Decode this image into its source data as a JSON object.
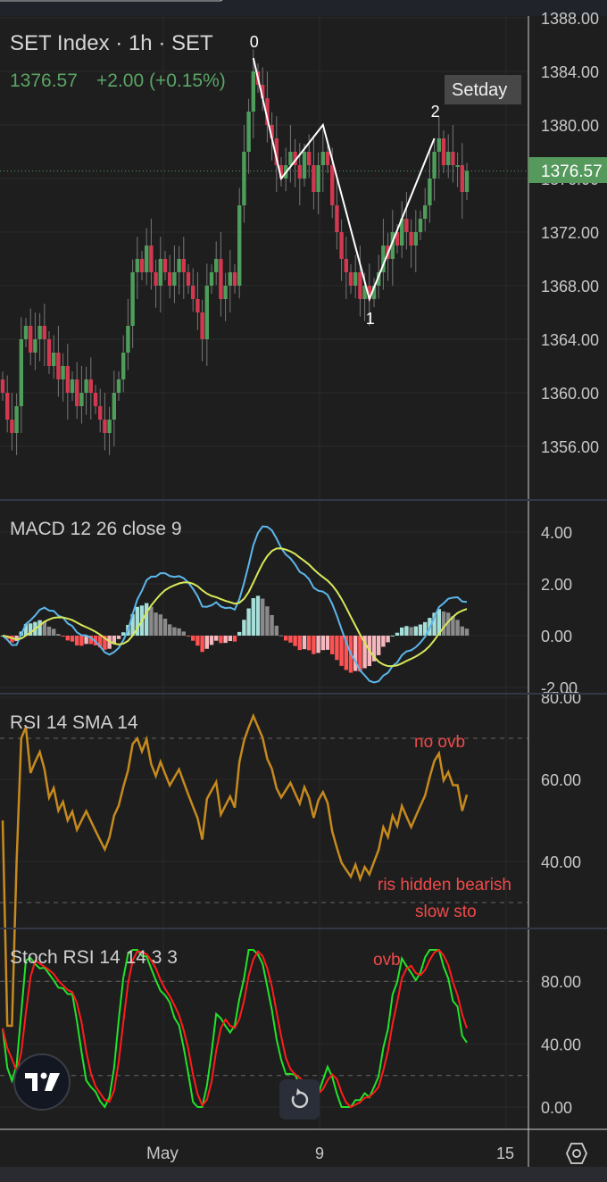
{
  "header": {
    "title": "SET Index · 1h · SET",
    "last": "1376.57",
    "change": "+2.00 (+0.15%)",
    "last_price_tag": "1376.57",
    "legend_badge": "Setday"
  },
  "colors": {
    "up": "#4f9d5a",
    "down": "#d2384f",
    "macd": "#5cb6ea",
    "signal": "#d8e85a",
    "rsi": "#c68a1e",
    "stoch_k": "#22e22a",
    "stoch_d": "#ff1c1c",
    "note": "#f04a4a"
  },
  "chart_data": [
    {
      "type": "candlestick",
      "title": "SET Index · 1h · SET",
      "ylim": [
        1354,
        1388
      ],
      "yticks": [
        "1388.00",
        "1384.00",
        "1380.00",
        "1376.00",
        "1372.00",
        "1368.00",
        "1364.00",
        "1360.00",
        "1356.00"
      ],
      "close": [
        1360,
        1358,
        1357,
        1359,
        1364,
        1365,
        1363,
        1364,
        1365,
        1364,
        1362,
        1363,
        1361,
        1362,
        1360,
        1361,
        1359,
        1360,
        1361,
        1360,
        1359,
        1358,
        1357,
        1358,
        1360,
        1361,
        1363,
        1365,
        1369,
        1370,
        1369,
        1371,
        1369,
        1368,
        1370,
        1369,
        1368,
        1369,
        1370,
        1369,
        1368,
        1367,
        1366,
        1364,
        1368,
        1369,
        1370,
        1367,
        1368,
        1369,
        1368,
        1374,
        1378,
        1381,
        1384,
        1383,
        1382,
        1380,
        1379,
        1377,
        1376,
        1377,
        1378,
        1377,
        1376,
        1378,
        1377,
        1375,
        1377,
        1378,
        1377,
        1374,
        1372,
        1370,
        1369,
        1368,
        1369,
        1367,
        1368,
        1367,
        1368,
        1369,
        1371,
        1370,
        1372,
        1371,
        1373,
        1372,
        1371,
        1372,
        1373,
        1374,
        1376,
        1378,
        1379,
        1377,
        1378,
        1377,
        1377,
        1375,
        1376.57
      ],
      "wave_labels": [
        "0",
        "1",
        "2"
      ],
      "wave_points": [
        [
          54,
          1385
        ],
        [
          60,
          1376
        ],
        [
          69,
          1380
        ],
        [
          79,
          1367
        ],
        [
          93,
          1379
        ]
      ]
    },
    {
      "type": "line",
      "title": "MACD 12 26 close 9",
      "series": [
        "MACD",
        "Signal",
        "Histogram"
      ],
      "yticks": [
        "4.00",
        "2.00",
        "0.00",
        "-2.00"
      ]
    },
    {
      "type": "line",
      "title": "RSI 14 SMA 14",
      "yticks": [
        "80.00",
        "60.00",
        "40.00"
      ],
      "bands": [
        70,
        30
      ],
      "annotations": [
        "no ovb",
        "ris hidden bearish",
        "slow sto"
      ]
    },
    {
      "type": "line",
      "title": "Stoch RSI 14 14 3 3",
      "yticks": [
        "80.00",
        "40.00",
        "0.00"
      ],
      "bands": [
        80,
        20
      ],
      "annotations": [
        "ovb"
      ]
    }
  ],
  "time_axis": [
    "May",
    "9",
    "15"
  ]
}
